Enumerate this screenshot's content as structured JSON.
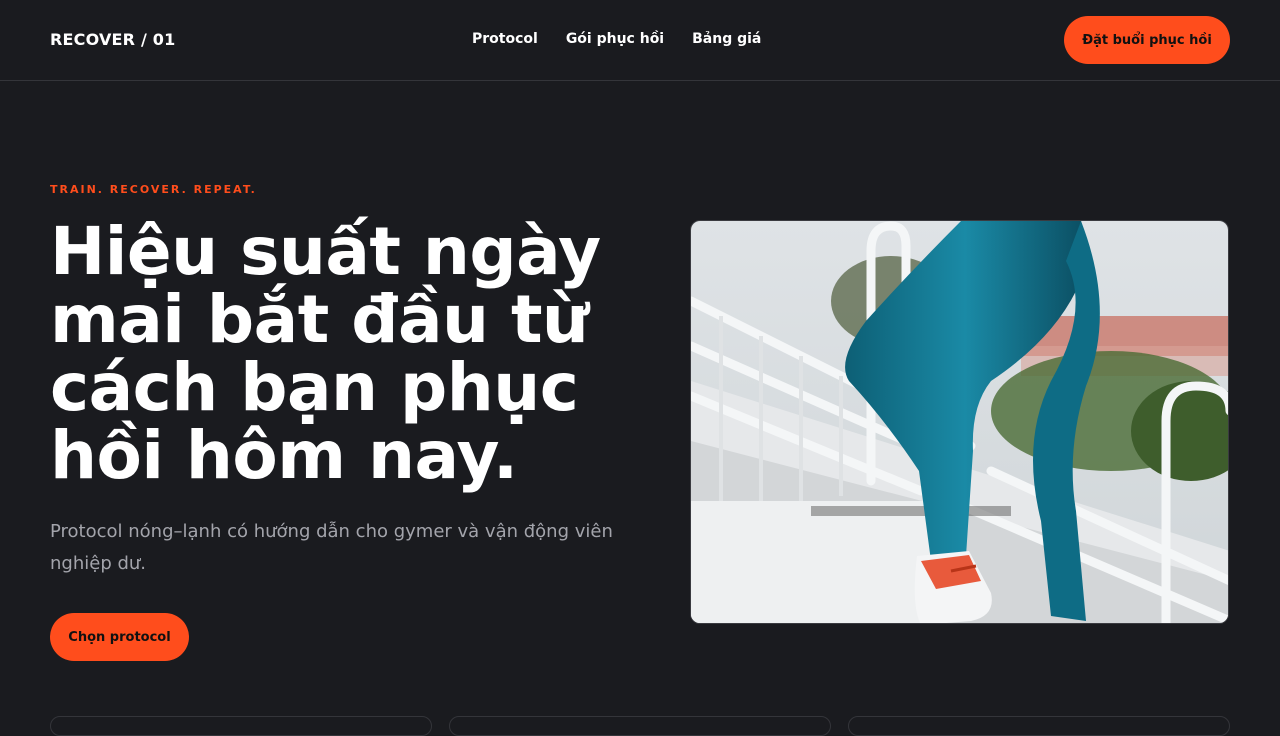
{
  "brand": "RECOVER / 01",
  "nav": {
    "links": [
      "Protocol",
      "Gói phục hồi",
      "Bảng giá"
    ],
    "cta": "Đặt buổi phục hồi"
  },
  "hero": {
    "eyebrow": "TRAIN. RECOVER. REPEAT.",
    "headline_lines": [
      "Hiệu suất ngày",
      "mai bắt đầu từ",
      "cách bạn phục",
      "hồi hôm nay."
    ],
    "subtitle": "Protocol nóng–lạnh có hướng dẫn cho gymer và vận động viên nghiệp dư.",
    "cta": "Chọn protocol"
  },
  "colors": {
    "background": "#1a1b1f",
    "accent": "#ff4d1c",
    "muted_text": "#a3a4ab"
  }
}
